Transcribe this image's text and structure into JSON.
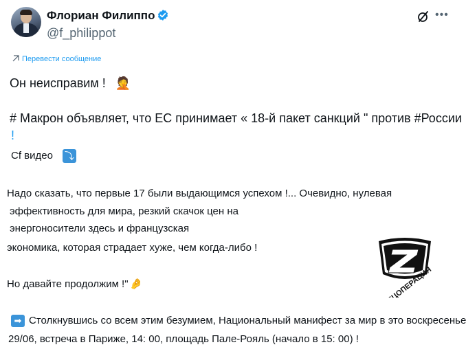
{
  "author": {
    "name": "Флориан Филиппо",
    "handle": "@f_philippot"
  },
  "icons": {
    "verified": "verified-badge-icon",
    "grok": "grok-icon",
    "more": "more-options-icon",
    "translate": "translate-icon",
    "video_arrow": "arrow-down-right-icon",
    "bullet_arrow": "arrow-right-icon"
  },
  "colors": {
    "accent": "#1d9bf0",
    "text": "#0f1419",
    "muted": "#536471"
  },
  "translate_label": "Перевести сообщение",
  "post": {
    "line1": "Он неисправим !",
    "line2": "# Макрон объявляет, что ЕС принимает « 18-й пакет санкций \" против #России",
    "line2b": "!",
    "line3": "Cf видео",
    "para_a": "Надо сказать, что первые 17 были выдающимся успехом !... Очевидно, нулевая",
    "para_b": "эффективность для мира, резкий скачок цен на",
    "para_c": "энергоносители здесь и французская",
    "para_d": "экономика, которая страдает хуже, чем когда-либо !",
    "line5": "Но давайте продолжим !\"",
    "line6a": "Столкнувшись со всем этим безумием, Национальный манифест за мир в это воскресенье,",
    "line6b": "29/06, встреча в Париже, 14: 00, площадь Пале-Рояль (начало в 15: 00) !"
  },
  "watermark": {
    "letter": "Z",
    "text": "СПЕЦОПЕРАЦИЯ"
  }
}
